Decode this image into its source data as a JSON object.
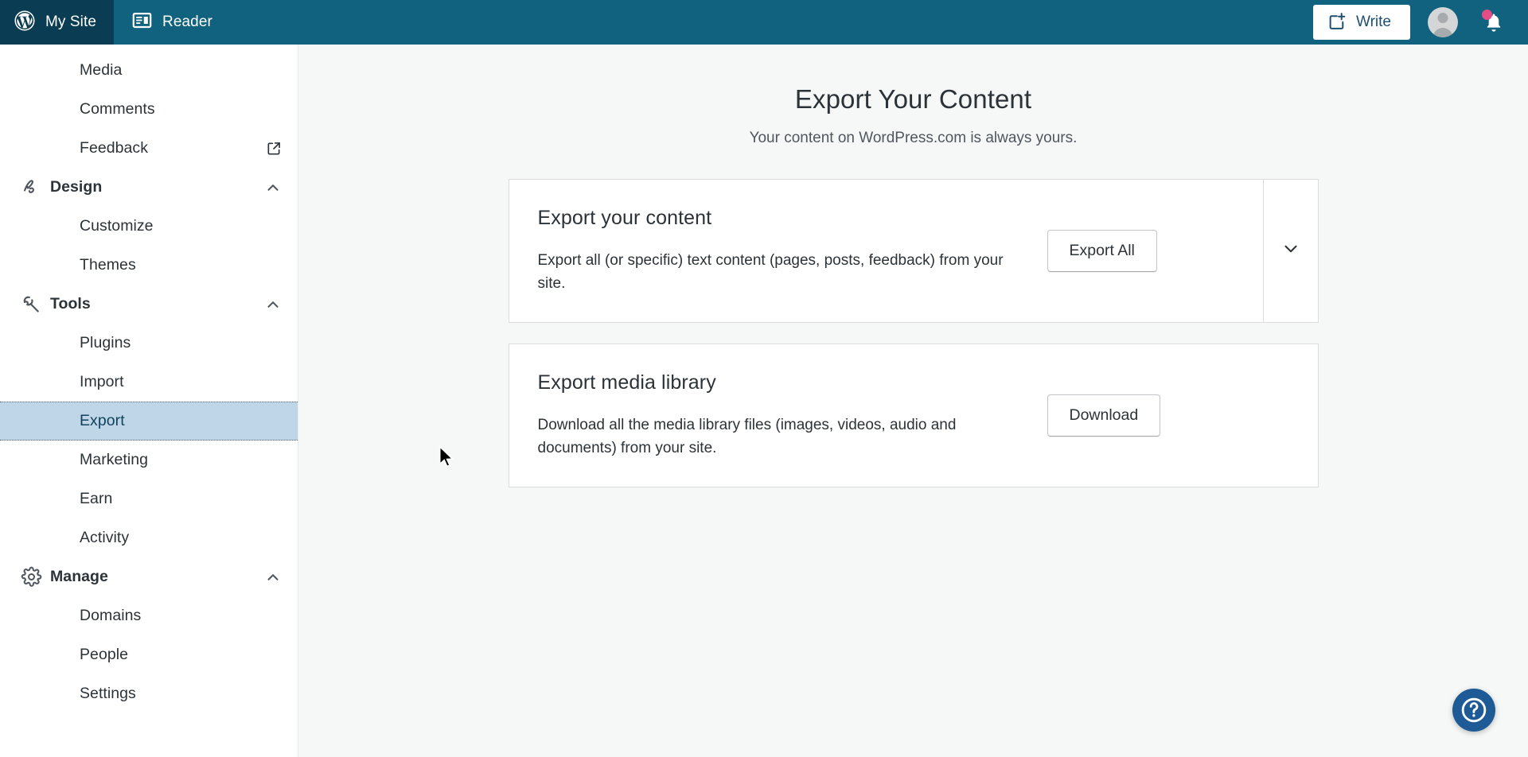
{
  "masthead": {
    "my_site_label": "My Site",
    "reader_label": "Reader",
    "write_label": "Write",
    "wordpress_logo_icon": "wordpress-logo-icon",
    "reader_icon": "reader-icon",
    "write_icon": "write-plus-icon",
    "avatar_icon": "user-avatar",
    "bell_icon": "notifications-bell-icon",
    "bell_has_unread": true,
    "bar_color": "#11627f",
    "my_site_color": "#0a3d53",
    "notification_dot_color": "#e34c84"
  },
  "sidebar": {
    "selected_item": "Export",
    "selected_bg_color": "#bfd6e8",
    "items": [
      {
        "label": "Media",
        "type": "child",
        "icon": "",
        "trail": ""
      },
      {
        "label": "Comments",
        "type": "child",
        "icon": "",
        "trail": ""
      },
      {
        "label": "Feedback",
        "type": "child",
        "icon": "",
        "trail": "external-link-icon"
      },
      {
        "label": "Design",
        "type": "header",
        "icon": "brush-icon",
        "trail": "chevron-up-icon"
      },
      {
        "label": "Customize",
        "type": "child",
        "icon": "",
        "trail": ""
      },
      {
        "label": "Themes",
        "type": "child",
        "icon": "",
        "trail": ""
      },
      {
        "label": "Tools",
        "type": "header",
        "icon": "wrench-icon",
        "trail": "chevron-up-icon"
      },
      {
        "label": "Plugins",
        "type": "child",
        "icon": "",
        "trail": ""
      },
      {
        "label": "Import",
        "type": "child",
        "icon": "",
        "trail": ""
      },
      {
        "label": "Export",
        "type": "child",
        "icon": "",
        "trail": "",
        "selected": true
      },
      {
        "label": "Marketing",
        "type": "child",
        "icon": "",
        "trail": ""
      },
      {
        "label": "Earn",
        "type": "child",
        "icon": "",
        "trail": ""
      },
      {
        "label": "Activity",
        "type": "child",
        "icon": "",
        "trail": ""
      },
      {
        "label": "Manage",
        "type": "header",
        "icon": "gear-icon",
        "trail": "chevron-up-icon"
      },
      {
        "label": "Domains",
        "type": "child",
        "icon": "",
        "trail": ""
      },
      {
        "label": "People",
        "type": "child",
        "icon": "",
        "trail": ""
      },
      {
        "label": "Settings",
        "type": "child",
        "icon": "",
        "trail": ""
      }
    ]
  },
  "main": {
    "title": "Export Your Content",
    "subtitle": "Your content on WordPress.com is always yours.",
    "cards": [
      {
        "heading": "Export your content",
        "description": "Export all (or specific) text content (pages, posts, feedback) from your site.",
        "button_label": "Export All",
        "has_expander": true,
        "expander_icon": "chevron-down-icon"
      },
      {
        "heading": "Export media library",
        "description": "Download all the media library files (images, videos, audio and documents) from your site.",
        "button_label": "Download",
        "has_expander": false,
        "expander_icon": ""
      }
    ]
  },
  "help": {
    "icon": "help-question-icon",
    "color": "#1e5b96"
  }
}
